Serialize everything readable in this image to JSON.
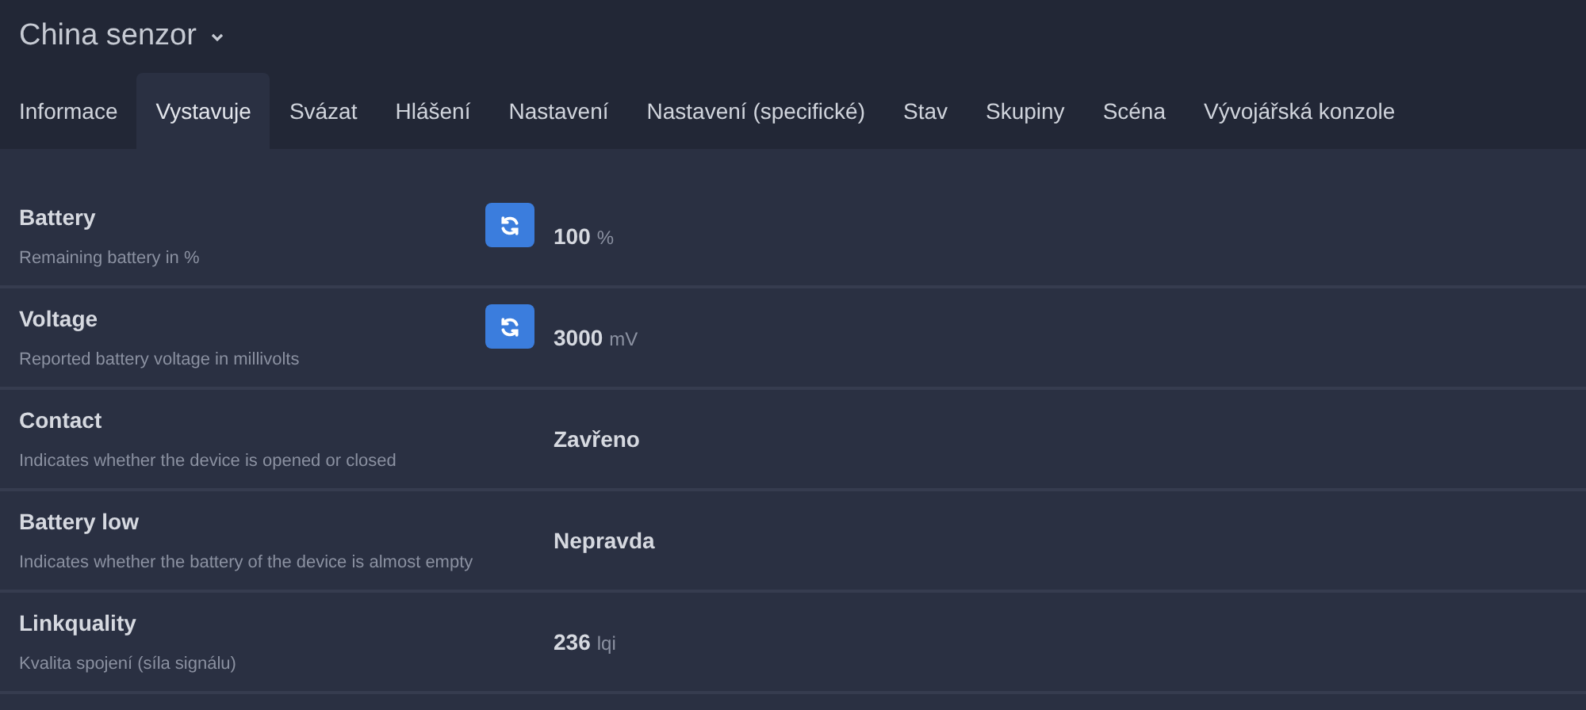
{
  "device": {
    "title": "China senzor"
  },
  "tabs": [
    {
      "label": "Informace",
      "selected": false
    },
    {
      "label": "Vystavuje",
      "selected": true
    },
    {
      "label": "Svázat",
      "selected": false
    },
    {
      "label": "Hlášení",
      "selected": false
    },
    {
      "label": "Nastavení",
      "selected": false
    },
    {
      "label": "Nastavení (specifické)",
      "selected": false
    },
    {
      "label": "Stav",
      "selected": false
    },
    {
      "label": "Skupiny",
      "selected": false
    },
    {
      "label": "Scéna",
      "selected": false
    },
    {
      "label": "Vývojářská konzole",
      "selected": false
    }
  ],
  "exposes": [
    {
      "name": "Battery",
      "description": "Remaining battery in %",
      "refresh": true,
      "value": "100",
      "unit": "%"
    },
    {
      "name": "Voltage",
      "description": "Reported battery voltage in millivolts",
      "refresh": true,
      "value": "3000",
      "unit": "mV"
    },
    {
      "name": "Contact",
      "description": "Indicates whether the device is opened or closed",
      "refresh": false,
      "value": "Zavřeno"
    },
    {
      "name": "Battery low",
      "description": "Indicates whether the battery of the device is almost empty",
      "refresh": false,
      "value": "Nepravda"
    },
    {
      "name": "Linkquality",
      "description": "Kvalita spojení (síla signálu)",
      "refresh": false,
      "value": "236",
      "unit": "lqi"
    }
  ]
}
